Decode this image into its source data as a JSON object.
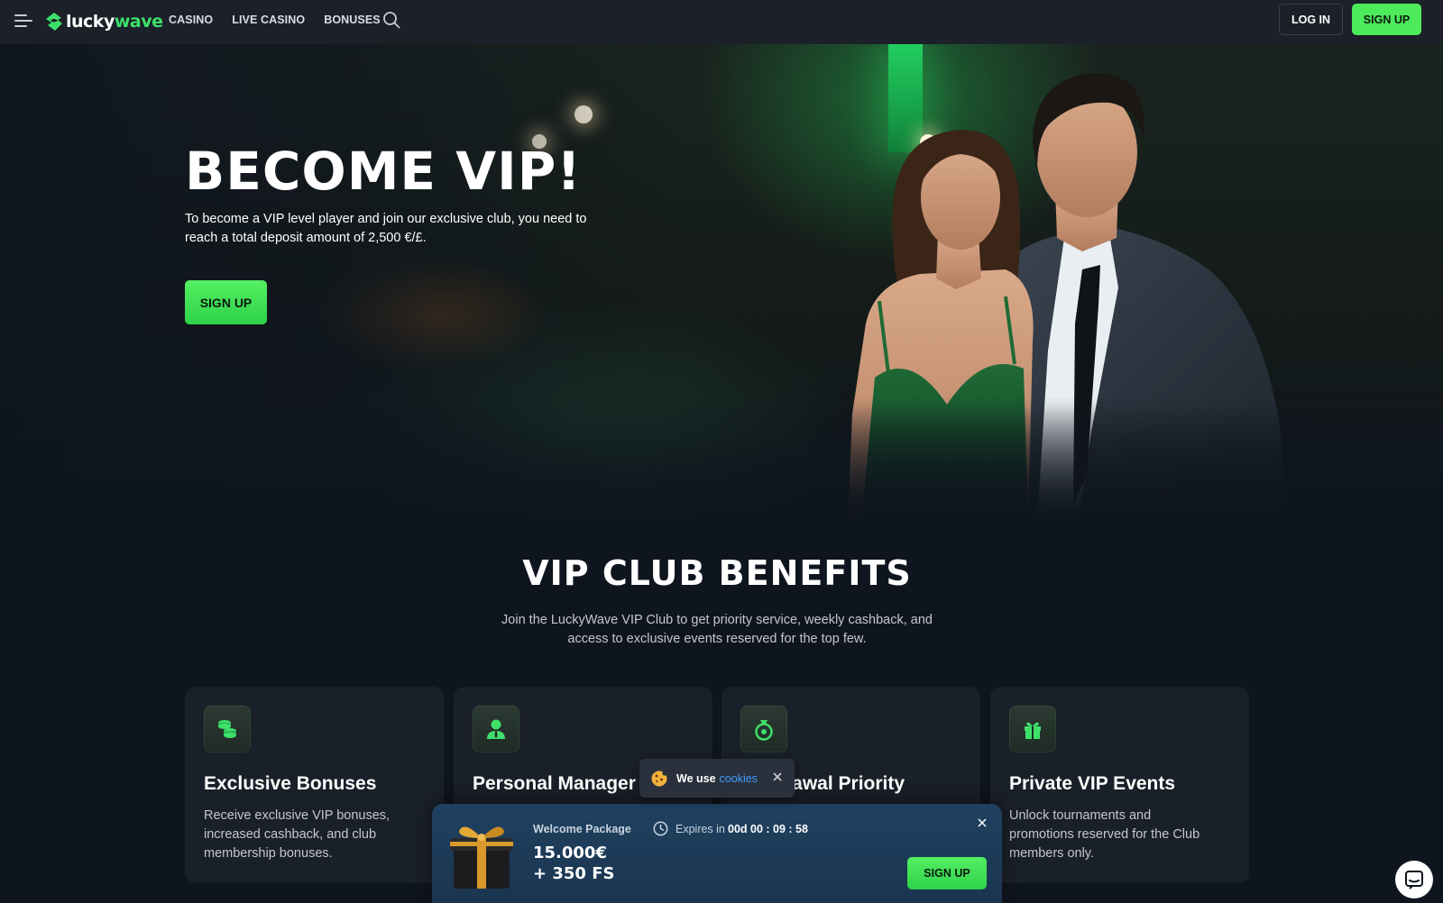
{
  "header": {
    "logo": {
      "part1": "lucky",
      "part2": "wave"
    },
    "nav": [
      {
        "label": "CASINO"
      },
      {
        "label": "LIVE CASINO"
      },
      {
        "label": "BONUSES"
      }
    ],
    "login_label": "LOG IN",
    "signup_label": "SIGN UP"
  },
  "hero": {
    "title": "BECOME VIP!",
    "description": "To become a VIP level player and join our exclusive club, you need to reach a total deposit amount of 2,500 €/£.",
    "signup_label": "SIGN UP"
  },
  "benefits": {
    "title": "VIP CLUB BENEFITS",
    "description": "Join the LuckyWave VIP Club to get priority service, weekly cashback, and access to exclusive events reserved for the top few.",
    "cards": [
      {
        "icon": "coins-icon",
        "title": "Exclusive Bonuses",
        "description": "Receive exclusive VIP bonuses, increased cashback, and club membership bonuses."
      },
      {
        "icon": "manager-icon",
        "title": "Personal Manager",
        "description": ""
      },
      {
        "icon": "money-bag-icon",
        "title": "Withdrawal Priority",
        "visible_title": "rawal Priority",
        "description": ""
      },
      {
        "icon": "gift-icon",
        "title": "Private VIP Events",
        "description": "Unlock tournaments and promotions reserved for the Club members only."
      }
    ]
  },
  "cookie_notice": {
    "text": "We use",
    "link": "cookies"
  },
  "welcome_package": {
    "label": "Welcome Package",
    "amount_line1": "15.000€",
    "amount_line2": "+ 350 FS",
    "expires_label": "Expires in",
    "expires_value": "00d 00 : 09 : 58",
    "signup_label": "SIGN UP"
  },
  "colors": {
    "accent_green": "#4dea5c",
    "background": "#0f151e",
    "card": "#1a2029",
    "link_blue": "#3f9dff",
    "welcome_bg": "#1f4160"
  }
}
